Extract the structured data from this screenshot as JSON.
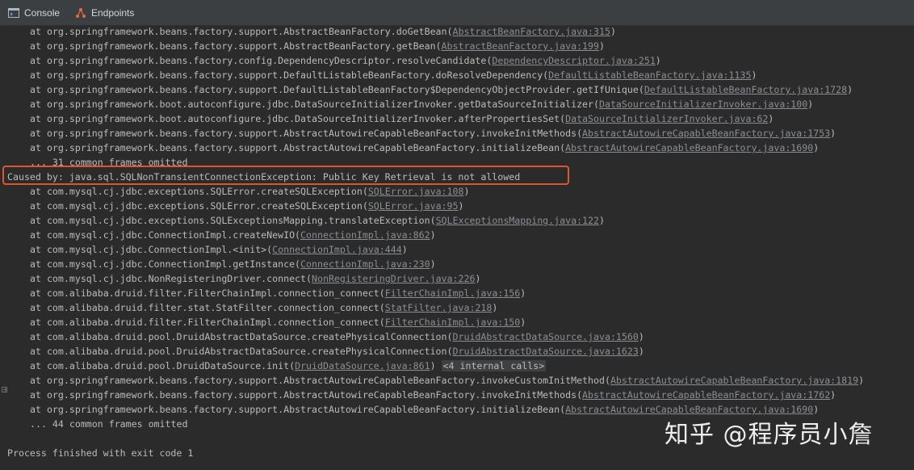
{
  "tabs": {
    "console": "Console",
    "endpoints": "Endpoints"
  },
  "colors": {
    "background": "#2b2b2b",
    "tab_bar": "#3c3f41",
    "text": "#bbbbbb",
    "link": "#8a8e94",
    "highlight_border": "#e0552d"
  },
  "lines": [
    {
      "text": "at org.springframework.beans.factory.support.AbstractBeanFactory.doGetBean(",
      "link": "AbstractBeanFactory.java:315",
      "suffix": ")"
    },
    {
      "text": "at org.springframework.beans.factory.support.AbstractBeanFactory.getBean(",
      "link": "AbstractBeanFactory.java:199",
      "suffix": ")"
    },
    {
      "text": "at org.springframework.beans.factory.config.DependencyDescriptor.resolveCandidate(",
      "link": "DependencyDescriptor.java:251",
      "suffix": ")"
    },
    {
      "text": "at org.springframework.beans.factory.support.DefaultListableBeanFactory.doResolveDependency(",
      "link": "DefaultListableBeanFactory.java:1135",
      "suffix": ")"
    },
    {
      "text": "at org.springframework.beans.factory.support.DefaultListableBeanFactory$DependencyObjectProvider.getIfUnique(",
      "link": "DefaultListableBeanFactory.java:1728",
      "suffix": ")"
    },
    {
      "text": "at org.springframework.boot.autoconfigure.jdbc.DataSourceInitializerInvoker.getDataSourceInitializer(",
      "link": "DataSourceInitializerInvoker.java:100",
      "suffix": ")"
    },
    {
      "text": "at org.springframework.boot.autoconfigure.jdbc.DataSourceInitializerInvoker.afterPropertiesSet(",
      "link": "DataSourceInitializerInvoker.java:62",
      "suffix": ")"
    },
    {
      "text": "at org.springframework.beans.factory.support.AbstractAutowireCapableBeanFactory.invokeInitMethods(",
      "link": "AbstractAutowireCapableBeanFactory.java:1753",
      "suffix": ")"
    },
    {
      "text": "at org.springframework.beans.factory.support.AbstractAutowireCapableBeanFactory.initializeBean(",
      "link": "AbstractAutowireCapableBeanFactory.java:1690",
      "suffix": ")"
    },
    {
      "text": "... 31 common frames omitted"
    },
    {
      "text": "Caused by: java.sql.SQLNonTransientConnectionException: Public Key Retrieval is not allowed",
      "caused": true
    },
    {
      "text": "at com.mysql.cj.jdbc.exceptions.SQLError.createSQLException(",
      "link": "SQLError.java:108",
      "suffix": ")"
    },
    {
      "text": "at com.mysql.cj.jdbc.exceptions.SQLError.createSQLException(",
      "link": "SQLError.java:95",
      "suffix": ")"
    },
    {
      "text": "at com.mysql.cj.jdbc.exceptions.SQLExceptionsMapping.translateException(",
      "link": "SQLExceptionsMapping.java:122",
      "suffix": ")"
    },
    {
      "text": "at com.mysql.cj.jdbc.ConnectionImpl.createNewIO(",
      "link": "ConnectionImpl.java:862",
      "suffix": ")"
    },
    {
      "text": "at com.mysql.cj.jdbc.ConnectionImpl.<init>(",
      "link": "ConnectionImpl.java:444",
      "suffix": ")"
    },
    {
      "text": "at com.mysql.cj.jdbc.ConnectionImpl.getInstance(",
      "link": "ConnectionImpl.java:230",
      "suffix": ")"
    },
    {
      "text": "at com.mysql.cj.jdbc.NonRegisteringDriver.connect(",
      "link": "NonRegisteringDriver.java:226",
      "suffix": ")"
    },
    {
      "text": "at com.alibaba.druid.filter.FilterChainImpl.connection_connect(",
      "link": "FilterChainImpl.java:156",
      "suffix": ")"
    },
    {
      "text": "at com.alibaba.druid.filter.stat.StatFilter.connection_connect(",
      "link": "StatFilter.java:218",
      "suffix": ")"
    },
    {
      "text": "at com.alibaba.druid.filter.FilterChainImpl.connection_connect(",
      "link": "FilterChainImpl.java:150",
      "suffix": ")"
    },
    {
      "text": "at com.alibaba.druid.pool.DruidAbstractDataSource.createPhysicalConnection(",
      "link": "DruidAbstractDataSource.java:1560",
      "suffix": ")"
    },
    {
      "text": "at com.alibaba.druid.pool.DruidAbstractDataSource.createPhysicalConnection(",
      "link": "DruidAbstractDataSource.java:1623",
      "suffix": ")"
    },
    {
      "text": "at com.alibaba.druid.pool.DruidDataSource.init(",
      "link": "DruidDataSource.java:861",
      "suffix": ") ",
      "internal": "<4 internal calls>"
    },
    {
      "text": "at org.springframework.beans.factory.support.AbstractAutowireCapableBeanFactory.invokeCustomInitMethod(",
      "link": "AbstractAutowireCapableBeanFactory.java:1819",
      "suffix": ")"
    },
    {
      "text": "at org.springframework.beans.factory.support.AbstractAutowireCapableBeanFactory.invokeInitMethods(",
      "link": "AbstractAutowireCapableBeanFactory.java:1762",
      "suffix": ")"
    },
    {
      "text": "at org.springframework.beans.factory.support.AbstractAutowireCapableBeanFactory.initializeBean(",
      "link": "AbstractAutowireCapableBeanFactory.java:1690",
      "suffix": ")"
    },
    {
      "text": "... 44 common frames omitted"
    },
    {
      "text": ""
    },
    {
      "text": "Process finished with exit code 1",
      "process": true
    }
  ],
  "watermark": "知乎 @程序员小詹"
}
